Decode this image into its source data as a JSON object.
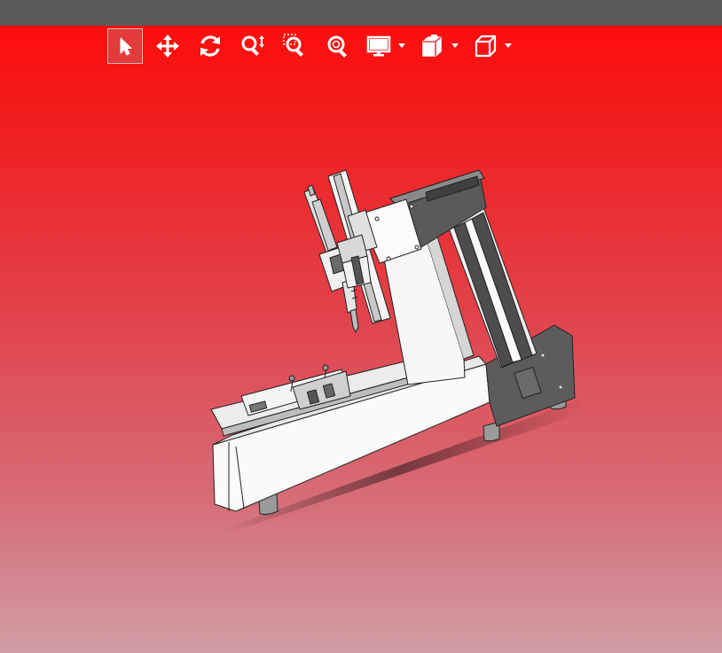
{
  "window": {
    "title": ""
  },
  "toolbar": {
    "tools": [
      {
        "id": "select",
        "icon": "cursor-arrow-icon",
        "active": true
      },
      {
        "id": "pan",
        "icon": "move-arrows-icon",
        "active": false
      },
      {
        "id": "rotate",
        "icon": "rotate-icon",
        "active": false
      },
      {
        "id": "zoom",
        "icon": "zoom-updown-icon",
        "active": false
      },
      {
        "id": "zoom-window",
        "icon": "zoom-window-icon",
        "active": false
      },
      {
        "id": "zoom-fit",
        "icon": "zoom-fit-icon",
        "active": false
      },
      {
        "id": "display-mode",
        "icon": "monitor-icon",
        "dropdown": true
      },
      {
        "id": "section-view",
        "icon": "section-cube-icon",
        "dropdown": true
      },
      {
        "id": "standard-views",
        "icon": "cube-icon",
        "dropdown": true
      }
    ]
  },
  "colors": {
    "title_bar": "#595959",
    "background_top": "#ff0d0d",
    "background_bottom": "#d19da3",
    "icon": "#ffffff",
    "active_tool": "#e23b3b",
    "model_light": "#ffffff",
    "model_dark": "#5a5a5a"
  }
}
